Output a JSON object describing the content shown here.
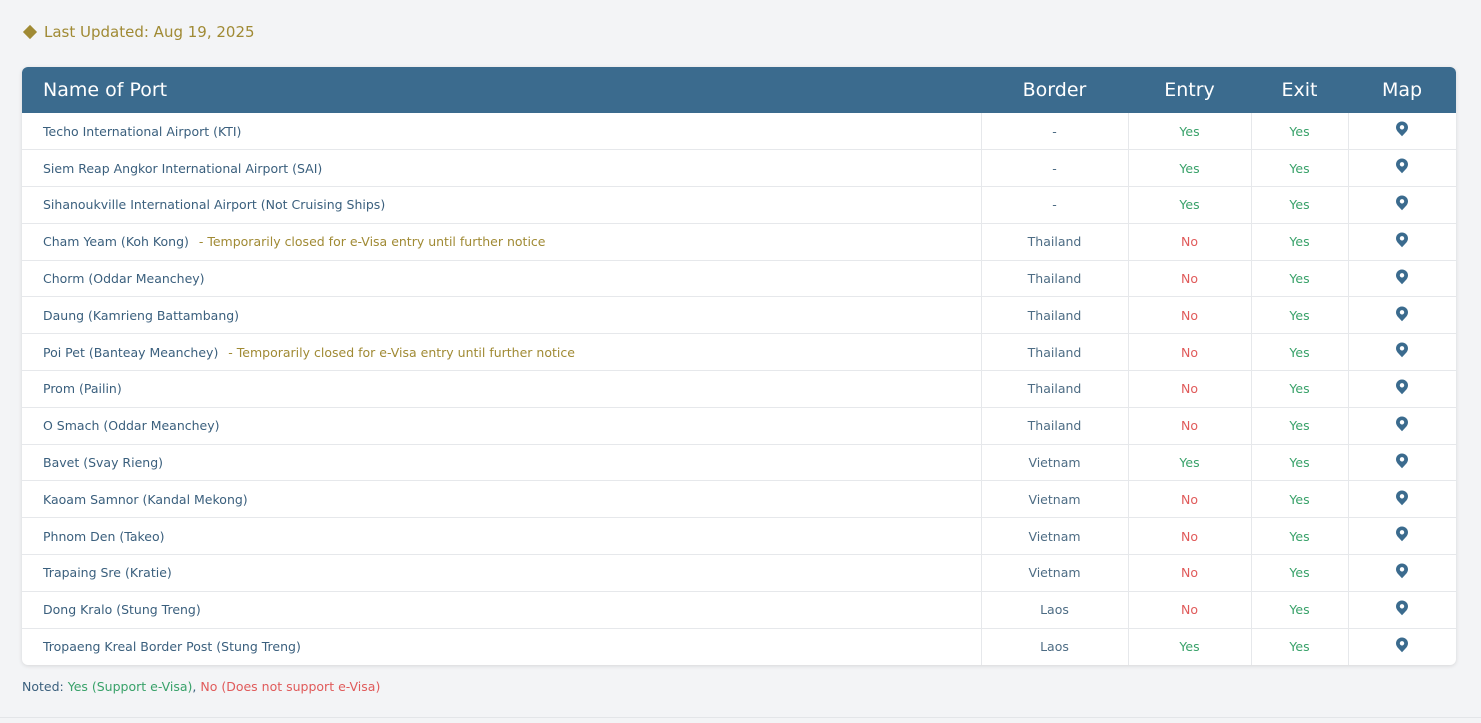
{
  "header": {
    "last_updated": "Last Updated: Aug 19, 2025"
  },
  "table": {
    "columns": [
      "Name of Port",
      "Border",
      "Entry",
      "Exit",
      "Map"
    ],
    "rows": [
      {
        "name": "Techo International Airport (KTI)",
        "notice": "",
        "border": "-",
        "entry": "Yes",
        "exit": "Yes"
      },
      {
        "name": "Siem Reap Angkor International Airport (SAI)",
        "notice": "",
        "border": "-",
        "entry": "Yes",
        "exit": "Yes"
      },
      {
        "name": "Sihanoukville International Airport (Not Cruising Ships)",
        "notice": "",
        "border": "-",
        "entry": "Yes",
        "exit": "Yes"
      },
      {
        "name": "Cham Yeam (Koh Kong)",
        "notice": " - Temporarily closed for e-Visa entry until further notice",
        "border": "Thailand",
        "entry": "No",
        "exit": "Yes"
      },
      {
        "name": "Chorm (Oddar Meanchey)",
        "notice": "",
        "border": "Thailand",
        "entry": "No",
        "exit": "Yes"
      },
      {
        "name": "Daung (Kamrieng Battambang)",
        "notice": "",
        "border": "Thailand",
        "entry": "No",
        "exit": "Yes"
      },
      {
        "name": "Poi Pet (Banteay Meanchey)",
        "notice": " - Temporarily closed for e-Visa entry until further notice",
        "border": "Thailand",
        "entry": "No",
        "exit": "Yes"
      },
      {
        "name": "Prom (Pailin)",
        "notice": "",
        "border": "Thailand",
        "entry": "No",
        "exit": "Yes"
      },
      {
        "name": "O Smach (Oddar Meanchey)",
        "notice": "",
        "border": "Thailand",
        "entry": "No",
        "exit": "Yes"
      },
      {
        "name": "Bavet (Svay Rieng)",
        "notice": "",
        "border": "Vietnam",
        "entry": "Yes",
        "exit": "Yes"
      },
      {
        "name": "Kaoam Samnor (Kandal Mekong)",
        "notice": "",
        "border": "Vietnam",
        "entry": "No",
        "exit": "Yes"
      },
      {
        "name": "Phnom Den (Takeo)",
        "notice": "",
        "border": "Vietnam",
        "entry": "No",
        "exit": "Yes"
      },
      {
        "name": "Trapaing Sre (Kratie)",
        "notice": "",
        "border": "Vietnam",
        "entry": "No",
        "exit": "Yes"
      },
      {
        "name": "Dong Kralo (Stung Treng)",
        "notice": "",
        "border": "Laos",
        "entry": "No",
        "exit": "Yes"
      },
      {
        "name": "Tropaeng Kreal Border Post (Stung Treng)",
        "notice": "",
        "border": "Laos",
        "entry": "Yes",
        "exit": "Yes"
      }
    ]
  },
  "footnote": {
    "prefix": "Noted: ",
    "yes_text": "Yes (Support e-Visa)",
    "separator": ", ",
    "no_text": "No (Does not support e-Visa)"
  },
  "colors": {
    "header_bg": "#3b6b8e",
    "accent_gold": "#a08a34",
    "yes": "#38a169",
    "no": "#e05a5a",
    "text": "#3a5f7d"
  },
  "icons": {
    "map": "map-pin-icon",
    "updated": "diamond-icon"
  }
}
